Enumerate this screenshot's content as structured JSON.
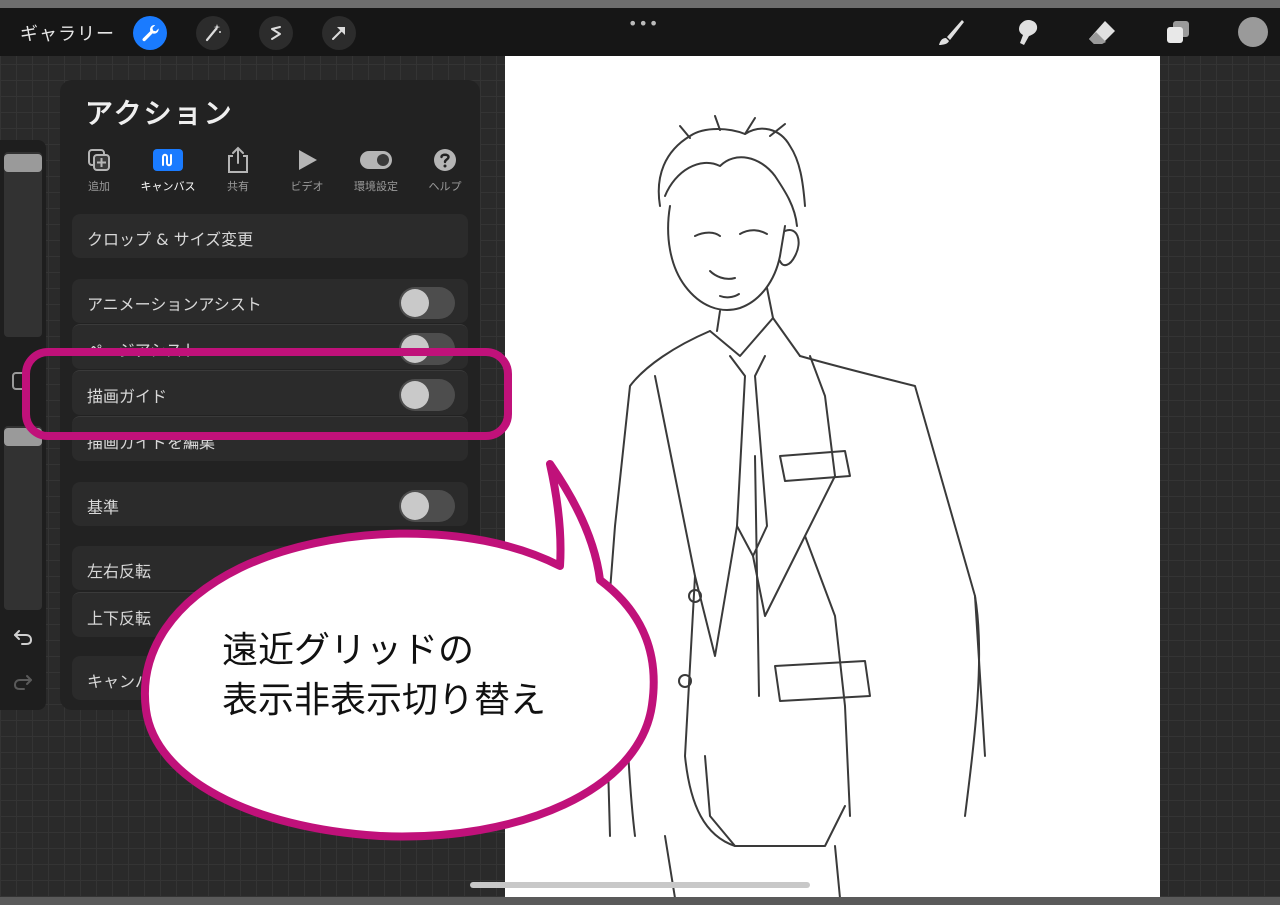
{
  "topbar": {
    "gallery_label": "ギャラリー",
    "left_tools": [
      {
        "icon": "wrench-icon",
        "active": true
      },
      {
        "icon": "magic-wand-icon",
        "active": false
      },
      {
        "icon": "selection-s-icon",
        "active": false
      },
      {
        "icon": "transform-arrow-icon",
        "active": false
      }
    ],
    "more_label": "•••",
    "right_tools": [
      "brush-icon",
      "smudge-icon",
      "eraser-icon",
      "layers-icon",
      "color-picker-icon"
    ]
  },
  "actions_panel": {
    "title": "アクション",
    "tabs": [
      {
        "label": "追加",
        "icon": "add-icon",
        "active": false
      },
      {
        "label": "キャンバス",
        "icon": "canvas-icon",
        "active": true
      },
      {
        "label": "共有",
        "icon": "share-icon",
        "active": false
      },
      {
        "label": "ビデオ",
        "icon": "play-icon",
        "active": false
      },
      {
        "label": "環境設定",
        "icon": "toggle-icon",
        "active": false
      },
      {
        "label": "ヘルプ",
        "icon": "help-icon",
        "active": false
      }
    ],
    "rows": {
      "crop": "クロップ & サイズ変更",
      "animation_assist": "アニメーションアシスト",
      "page_assist": "ページアシスト",
      "drawing_guide": "描画ガイド",
      "edit_drawing_guide": "描画ガイドを編集",
      "reference": "基準",
      "flip_horizontal": "左右反転",
      "flip_vertical": "上下反転",
      "canvas_info": "キャンバス情報"
    },
    "toggles": {
      "animation_assist": false,
      "page_assist": false,
      "drawing_guide": false,
      "reference": false
    }
  },
  "callout": {
    "line1": "遠近グリッドの",
    "line2": "表示非表示切り替え",
    "accent_color": "#c0117a"
  },
  "colors": {
    "accent": "#1a7bff",
    "panel": "#222222",
    "row": "#2b2b2b"
  }
}
